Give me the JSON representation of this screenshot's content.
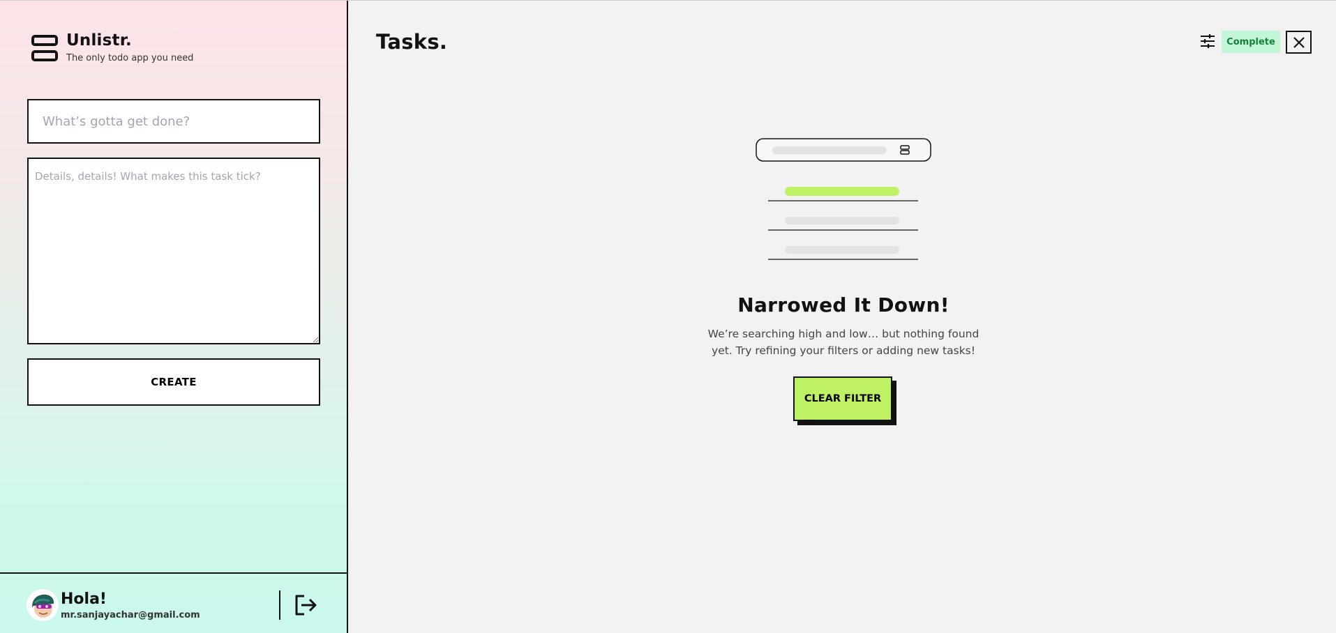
{
  "app": {
    "name": "Unlistr.",
    "tagline": "The only todo app you need"
  },
  "create_form": {
    "title_placeholder": "What’s gotta get done?",
    "description_placeholder": "Details, details! What makes this task tick?",
    "create_label": "CREATE"
  },
  "user": {
    "greeting": "Hola!",
    "email": "mr.sanjayachar@gmail.com"
  },
  "main": {
    "title": "Tasks.",
    "status_filter": "Complete",
    "empty_state": {
      "title": "Narrowed It Down!",
      "description": "We’re searching high and low… but nothing found yet. Try refining your filters or adding new tasks!",
      "clear_label": "CLEAR FILTER"
    }
  },
  "colors": {
    "accent_green": "#bef264",
    "status_chip_bg": "#c2f6d6",
    "status_chip_text": "#15803d"
  },
  "icons": {
    "brand": "stacked-rectangles-icon",
    "filter": "sliders-icon",
    "close": "close-icon",
    "logout": "logout-icon"
  }
}
